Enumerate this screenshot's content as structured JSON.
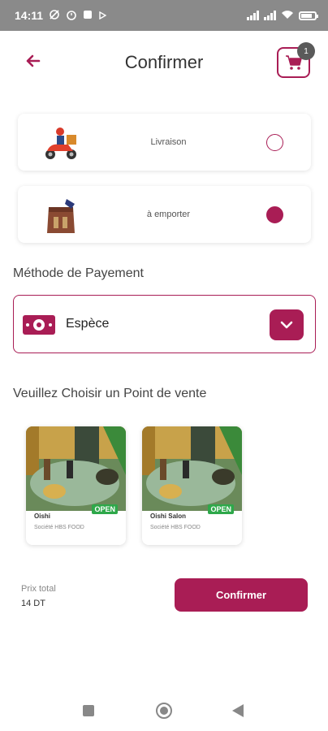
{
  "status_bar": {
    "time": "14:11"
  },
  "header": {
    "title": "Confirmer",
    "cart_count": "1"
  },
  "delivery_options": [
    {
      "label": "Livraison",
      "selected": false
    },
    {
      "label": "à emporter",
      "selected": true
    }
  ],
  "payment": {
    "section_title": "Méthode de Payement",
    "selected_method": "Espèce"
  },
  "stores": {
    "section_title": "Veuillez Choisir un Point de vente",
    "items": [
      {
        "name": "Oishi",
        "company": "Société HBS FOOD",
        "badge": "OPEN"
      },
      {
        "name": "Oishi Salon",
        "company": "Société HBS FOOD",
        "badge": "OPEN"
      }
    ]
  },
  "total": {
    "label": "Prix total",
    "value": "14 DT"
  },
  "confirm_button": {
    "label": "Confirmer"
  },
  "colors": {
    "accent": "#a91d55",
    "open_badge": "#2ea84a"
  }
}
